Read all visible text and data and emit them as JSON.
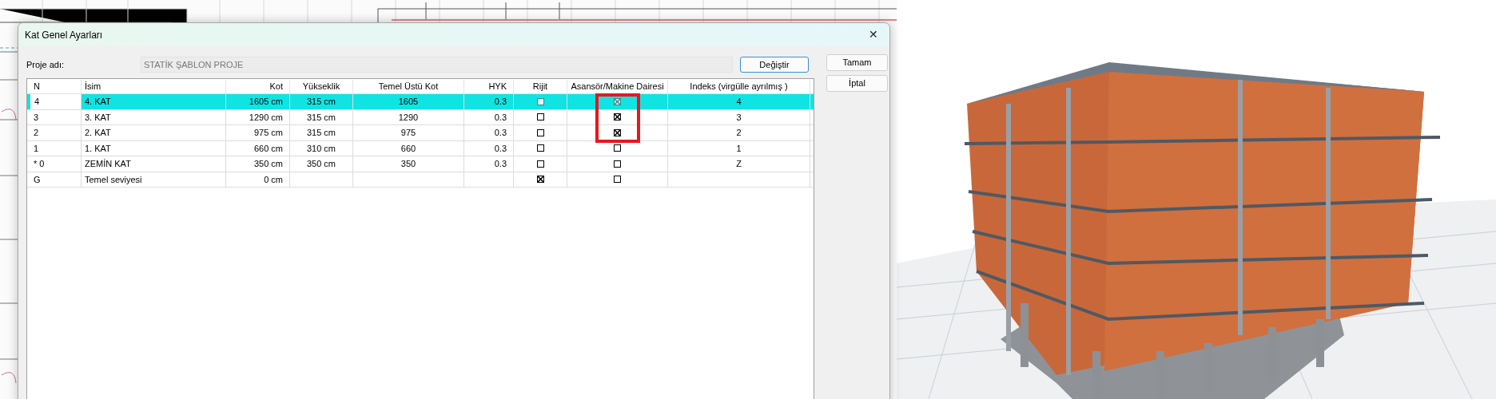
{
  "dialog": {
    "title": "Kat Genel Ayarları",
    "project_label": "Proje adı:",
    "project_name": "STATİK ŞABLON PROJE",
    "change_button": "Değiştir",
    "ok_button": "Tamam",
    "cancel_button": "İptal",
    "close_button": "✕"
  },
  "table": {
    "columns": [
      "N",
      "İsim",
      "Kot",
      "Yükseklik",
      "Temel Üstü Kot",
      "HYK",
      "Rijit",
      "Asansör/Makine Dairesi",
      "Indeks (virgülle ayrılmış )"
    ],
    "rows": [
      {
        "n": "4",
        "name": "4. KAT",
        "kot": "1605 cm",
        "height": "315 cm",
        "base_kot": "1605",
        "hyk": "0.3",
        "rigid": false,
        "elevator": true,
        "index": "4",
        "selected": true
      },
      {
        "n": "3",
        "name": "3. KAT",
        "kot": "1290 cm",
        "height": "315 cm",
        "base_kot": "1290",
        "hyk": "0.3",
        "rigid": false,
        "elevator": true,
        "index": "3",
        "selected": false
      },
      {
        "n": "2",
        "name": "2. KAT",
        "kot": "975 cm",
        "height": "315 cm",
        "base_kot": "975",
        "hyk": "0.3",
        "rigid": false,
        "elevator": true,
        "index": "2",
        "selected": false
      },
      {
        "n": "1",
        "name": "1. KAT",
        "kot": "660 cm",
        "height": "310 cm",
        "base_kot": "660",
        "hyk": "0.3",
        "rigid": false,
        "elevator": false,
        "index": "1",
        "selected": false
      },
      {
        "n": "* 0",
        "name": "ZEMİN KAT",
        "kot": "350 cm",
        "height": "350 cm",
        "base_kot": "350",
        "hyk": "0.3",
        "rigid": false,
        "elevator": false,
        "index": "Z",
        "selected": false
      },
      {
        "n": "G",
        "name": "Temel seviyesi",
        "kot": "0 cm",
        "rigid": true,
        "elevator": false,
        "selected": false
      }
    ]
  }
}
